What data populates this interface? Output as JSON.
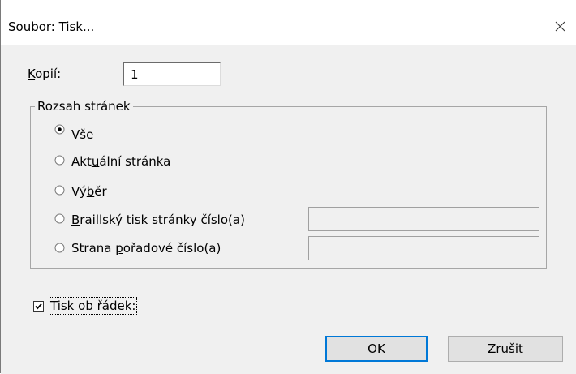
{
  "window": {
    "title": "Soubor: Tisk..."
  },
  "copies": {
    "label_accel": "K",
    "label_rest": "opií:",
    "value": "1"
  },
  "page_range": {
    "group_label": "Rozsah stránek",
    "selected": "all",
    "options": {
      "all": {
        "pre": "",
        "accel": "V",
        "post": "še"
      },
      "current": {
        "pre": "Akt",
        "accel": "u",
        "post": "ální stránka"
      },
      "selection": {
        "pre": "Vý",
        "accel": "b",
        "post": "ěr"
      },
      "braille": {
        "pre": "",
        "accel": "B",
        "post": "raillský tisk stránky číslo(a)",
        "input_value": ""
      },
      "sequence": {
        "pre": "Strana ",
        "accel": "p",
        "post": "ořadové číslo(a)",
        "input_value": ""
      }
    }
  },
  "print_every_other": {
    "label": "Tisk ob řádek:",
    "checked": true
  },
  "buttons": {
    "ok": "OK",
    "cancel": "Zrušit"
  },
  "colors": {
    "client_background": "#f0f0f0",
    "default_button_accent": "#0078d7"
  }
}
